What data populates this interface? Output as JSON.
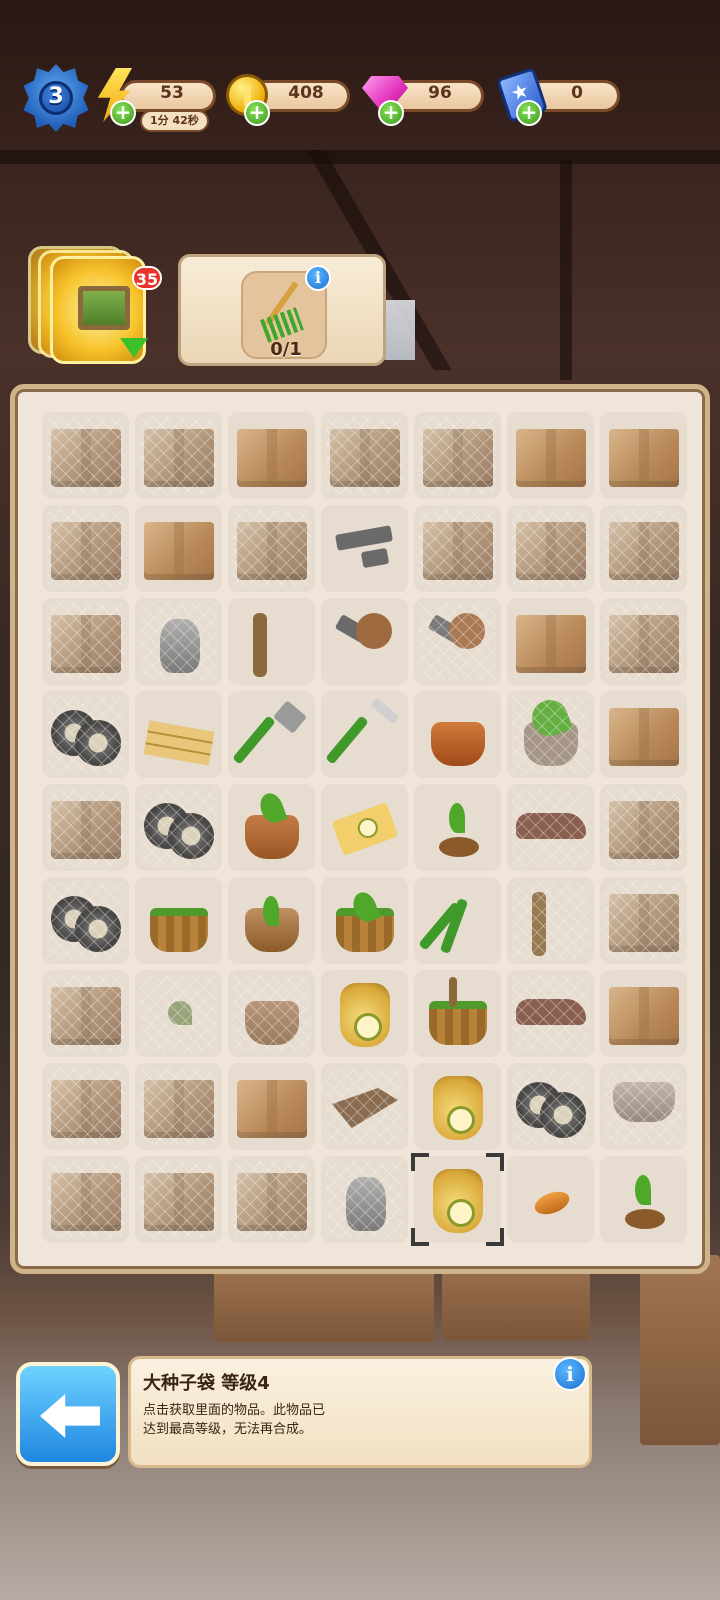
{
  "hud": {
    "level": "3",
    "energy": "53",
    "energy_timer": "1分 42秒",
    "coins": "408",
    "gems": "96",
    "cards": "0"
  },
  "order": {
    "badge_count": "35",
    "progress": "0/1",
    "icon_name": "rake-icon"
  },
  "board": {
    "rows": [
      [
        "box-web",
        "box-web",
        "box",
        "box-web",
        "box-web",
        "box",
        "box"
      ],
      [
        "box-web",
        "box",
        "box-web",
        "bolts",
        "box-web",
        "box-web",
        "box-web"
      ],
      [
        "box-web",
        "vase-web",
        "pipe",
        "screw",
        "screw-web",
        "box",
        "box-web"
      ],
      [
        "tires-web",
        "planks",
        "axe",
        "knife",
        "pot-broken",
        "tree-web",
        "box"
      ],
      [
        "box-web",
        "tires-web",
        "plant-pot",
        "seed-packet",
        "sprout-dirt",
        "shoes-web",
        "box-web"
      ],
      [
        "tires-web",
        "bucket",
        "pot-sprout",
        "bucket-green",
        "pliers",
        "pipe-web",
        "box-web"
      ],
      [
        "box-web",
        "clover-web",
        "pot-web",
        "seed-sack",
        "bucket-tools",
        "shoes-web",
        "box"
      ],
      [
        "box-web",
        "box-web",
        "box",
        "table-web",
        "seed-sack-big",
        "tires-web",
        "bowl-web"
      ],
      [
        "box-web",
        "box-web",
        "box-web",
        "vase-web",
        "seed-sack-big-selected",
        "bean",
        "sprout"
      ]
    ]
  },
  "info": {
    "title": "大种子袋 等级4",
    "description": "点击获取里面的物品。此物品已达到最高等级，无法再合成。"
  },
  "colors": {
    "board_bg": "#efe6d9",
    "plus_green": "#3a9a1c",
    "info_blue": "#1d6fd0",
    "badge_red": "#e8332a"
  }
}
